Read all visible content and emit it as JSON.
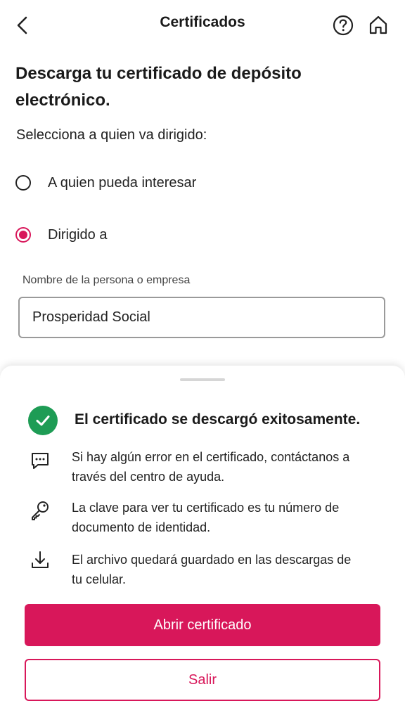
{
  "header": {
    "title": "Certificados",
    "back_icon": "chevron-left-icon",
    "help_icon": "help-circle-icon",
    "home_icon": "home-icon"
  },
  "main": {
    "heading": "Descarga tu certificado de depósito electrónico.",
    "subtitle": "Selecciona a quien va dirigido:",
    "options": [
      {
        "label": "A quien pueda interesar",
        "selected": false
      },
      {
        "label": "Dirigido a",
        "selected": true
      }
    ],
    "recipient_label": "Nombre de la persona o empresa",
    "recipient_value": "Prosperidad Social"
  },
  "sheet": {
    "success_message": "El certificado se descargó exitosamente.",
    "info": [
      {
        "icon": "chat-dots-icon",
        "text": "Si hay algún error en el certificado, contáctanos a través del centro de ayuda."
      },
      {
        "icon": "key-icon",
        "text": "La clave para ver tu certificado es tu número de documento de identidad."
      },
      {
        "icon": "download-icon",
        "text": "El archivo quedará guardado en las descargas de tu celular."
      }
    ],
    "primary_button": "Abrir certificado",
    "secondary_button": "Salir"
  },
  "colors": {
    "accent": "#d8175a",
    "success": "#1e9c55"
  }
}
